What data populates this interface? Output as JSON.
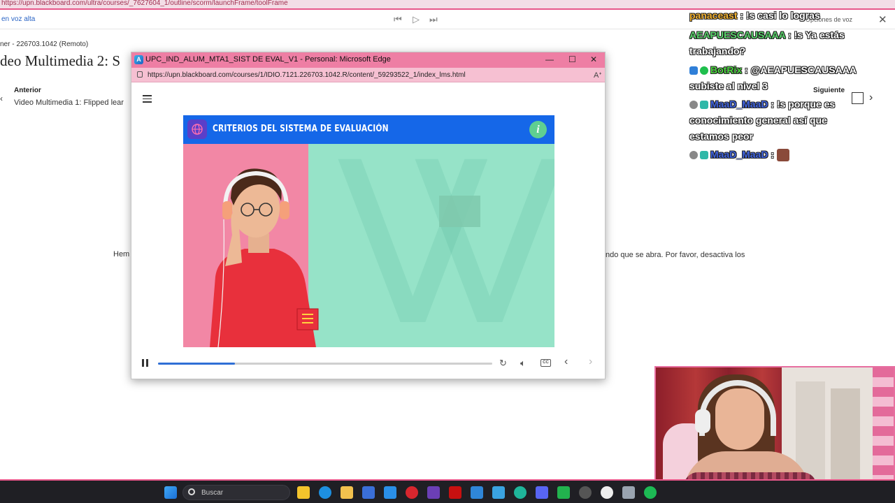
{
  "browser": {
    "url_fragment": "https://upn.blackboard.com/ultra/courses/_7627604_1/outline/scorm/launchFrame/toolFrame"
  },
  "read_aloud": {
    "label": "en voz alta",
    "voice_options": "Opciones de voz",
    "prev_icon": "skip-back-icon",
    "play_icon": "play-icon",
    "next_icon": "skip-forward-icon"
  },
  "background_page": {
    "course_id": "ner - 226703.1042 (Remoto)",
    "title": "deo Multimedia 2: S",
    "previous": {
      "label": "Anterior",
      "item": "Video Multimedia 1: Flipped lear"
    },
    "next": {
      "label": "Siguiente"
    },
    "message_left": "Hem",
    "message_right": "ndo que se abra. Por favor, desactiva los"
  },
  "popup_window": {
    "title": "UPC_IND_ALUM_MTA1_SIST DE EVAL_V1 - Personal: Microsoft Edge",
    "url": "https://upn.blackboard.com/courses/1/IDIO.7121.226703.1042.R/content/_59293522_1/index_lms.html",
    "controls": {
      "minimize": "—",
      "maximize": "☐",
      "close": "✕"
    }
  },
  "slide": {
    "title": "CRITERIOS DEL SISTEMA DE EVALUACIÓN",
    "info_icon": "i",
    "colors": {
      "header": "#1567e8",
      "left": "#f287a5",
      "right": "#96e3c8"
    }
  },
  "player": {
    "progress": 0.23,
    "icons": [
      "pause-icon",
      "replay-icon",
      "volume-icon",
      "captions-icon",
      "prev-slide-icon",
      "next-slide-icon"
    ],
    "cc_label": "CC"
  },
  "chat": [
    {
      "user": "panaceast",
      "text": "!s casi lo logras",
      "user_color": "#f0b030"
    },
    {
      "user": "AEAPUESCAUSAAA",
      "text": "!s Ya estás trabajando?",
      "user_color": "#59d36b"
    },
    {
      "user": "BotRix",
      "text": "@AEAPUESCAUSAAA subiste al nivel 3",
      "user_color": "#4cd640"
    },
    {
      "user": "MaaD_MaaD",
      "text": "!s porque es conocimiento general así que estamos peor",
      "user_color": "#3f63e0"
    },
    {
      "user": "MaaD_MaaD",
      "text": "",
      "user_color": "#3f63e0"
    }
  ],
  "taskbar": {
    "search_placeholder": "Buscar"
  }
}
